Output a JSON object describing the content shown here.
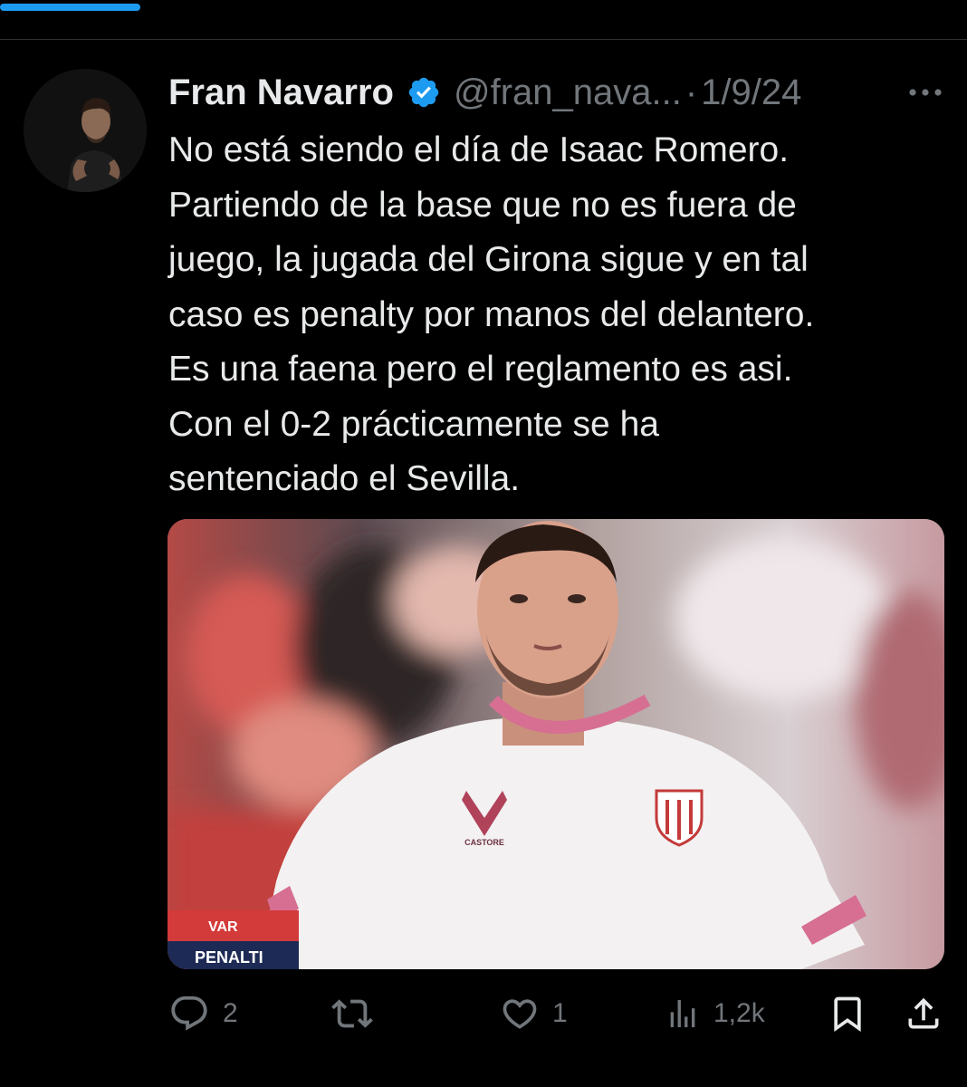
{
  "colors": {
    "background": "#000000",
    "text": "#e7e9ea",
    "muted": "#71767b",
    "accent": "#1d9bf0",
    "divider": "#2f3336"
  },
  "progress": {
    "fill_fraction": 0.145
  },
  "tweet": {
    "author": {
      "display_name": "Fran Navarro",
      "handle": "@fran_nava...",
      "verified": true,
      "avatar_icon": "avatar-photo"
    },
    "separator": "·",
    "date": "1/9/24",
    "more_icon": "more-horizontal-icon",
    "text_lines": [
      "No está siendo el día de Isaac Romero.",
      "Partiendo de la base que no es fuera de",
      "juego, la jugada del Girona sigue y en tal",
      "caso es penalty por manos del delantero.",
      "Es una faena pero el reglamento es asi.",
      "Con el 0-2 prácticamente se ha",
      "sentenciado el Sevilla."
    ],
    "media": {
      "var_label": "VAR",
      "var_sub_label": "PENALTI",
      "kit_brand": "CASTORE"
    },
    "actions": {
      "replies": "2",
      "reposts": "",
      "likes": "1",
      "views": "1,2k"
    }
  }
}
